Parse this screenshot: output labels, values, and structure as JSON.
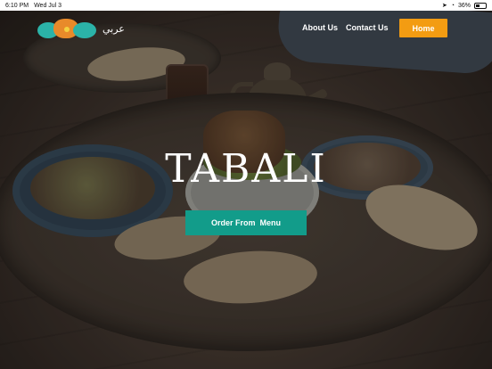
{
  "status_bar": {
    "time": "6:10 PM",
    "date": "Wed Jul 3",
    "battery": "36%"
  },
  "navbar": {
    "language_label": "عربي",
    "about_label": "About Us",
    "contact_label": "Contact Us",
    "home_label": "Home"
  },
  "hero": {
    "title": "TABALI",
    "order_button_label": "Order From  Menu"
  },
  "colors": {
    "home_button": "#f39c12",
    "order_button": "#129c8a",
    "logo_teal": "#2bb3a8",
    "logo_orange": "#e88a2a"
  }
}
